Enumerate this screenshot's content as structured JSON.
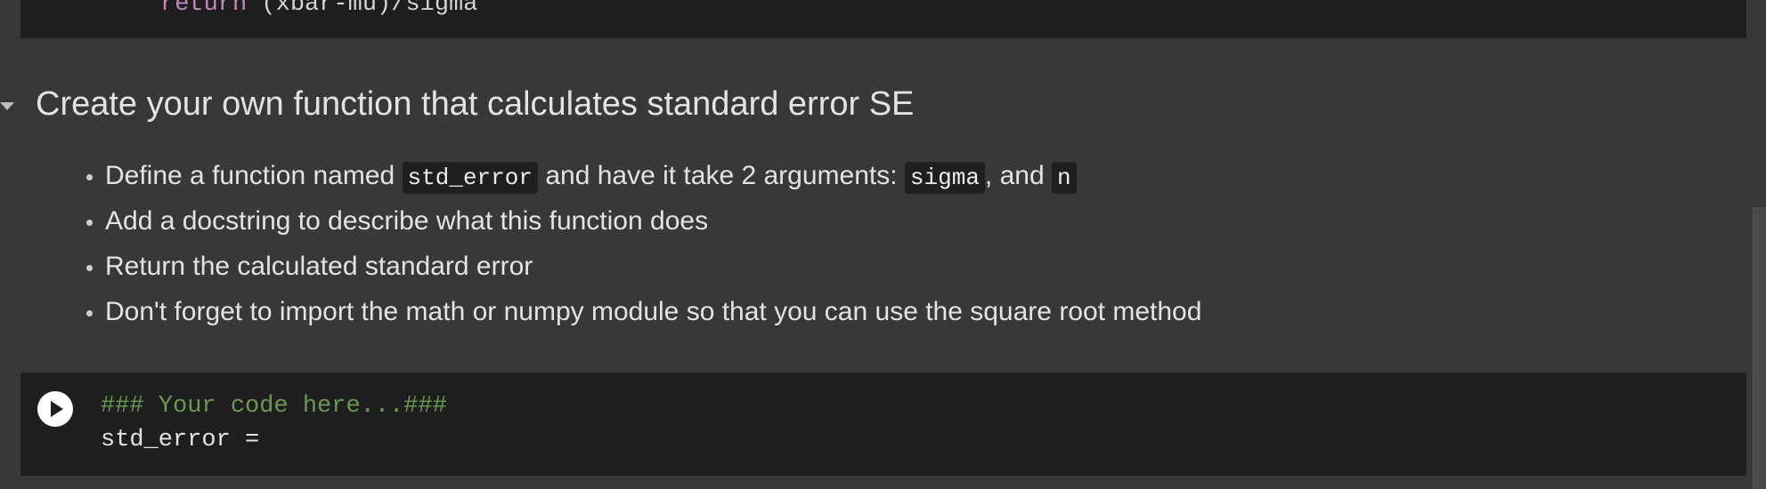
{
  "prev_cell": {
    "keyword": "return",
    "expr": " (xbar-mu)/sigma"
  },
  "section": {
    "heading": "Create your own function that calculates standard error SE",
    "bullets": [
      {
        "t1": "Define a function named ",
        "c1": "std_error",
        "t2": " and have it take 2 arguments: ",
        "c2": "sigma",
        "t3": ", and ",
        "c3": "n"
      },
      {
        "text": "Add a docstring to describe what this function does"
      },
      {
        "text": "Return the calculated standard error"
      },
      {
        "text": "Don't forget to import the math or numpy module so that you can use the square root method"
      }
    ]
  },
  "code_cell": {
    "comment": "### Your code here...###",
    "line2": "std_error ="
  },
  "colors": {
    "background": "#383838",
    "cell_background": "#1e1e1e",
    "comment": "#6a9955",
    "keyword": "#c586c0"
  },
  "icons": {
    "run": "play-icon",
    "collapse": "caret-down-icon"
  }
}
